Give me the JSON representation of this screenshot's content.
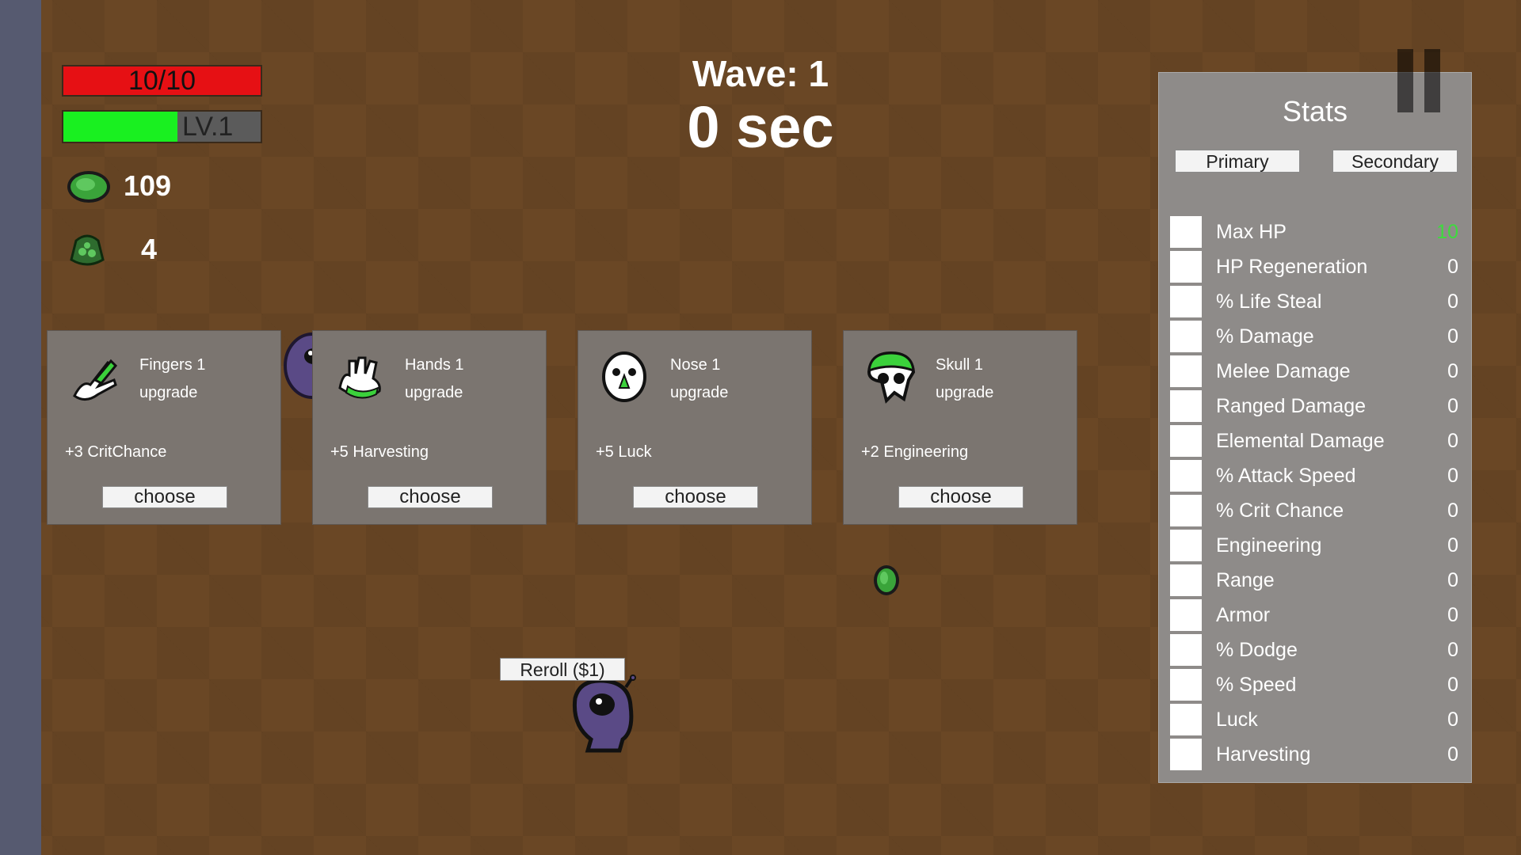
{
  "hud": {
    "hp_text": "10/10",
    "hp_fraction": 1.0,
    "level_text": "LV.1",
    "xp_fraction": 0.58,
    "materials_count": "109",
    "bag_count": "4"
  },
  "wave": {
    "title": "Wave: 1",
    "timer": "0 sec"
  },
  "cards": [
    {
      "name": "Fingers 1",
      "type": "upgrade",
      "effect": "+3 CritChance",
      "button": "choose",
      "icon": "fingers-icon"
    },
    {
      "name": "Hands 1",
      "type": "upgrade",
      "effect": "+5 Harvesting",
      "button": "choose",
      "icon": "hands-icon"
    },
    {
      "name": "Nose 1",
      "type": "upgrade",
      "effect": "+5 Luck",
      "button": "choose",
      "icon": "nose-icon"
    },
    {
      "name": "Skull 1",
      "type": "upgrade",
      "effect": "+2 Engineering",
      "button": "choose",
      "icon": "skull-icon"
    }
  ],
  "reroll_label": "Reroll ($1)",
  "stats": {
    "title": "Stats",
    "tab_primary": "Primary",
    "tab_secondary": "Secondary",
    "rows": [
      {
        "name": "Max HP",
        "value": "10"
      },
      {
        "name": "HP Regeneration",
        "value": "0"
      },
      {
        "name": "% Life Steal",
        "value": "0"
      },
      {
        "name": "% Damage",
        "value": "0"
      },
      {
        "name": "Melee Damage",
        "value": "0"
      },
      {
        "name": "Ranged Damage",
        "value": "0"
      },
      {
        "name": "Elemental Damage",
        "value": "0"
      },
      {
        "name": "% Attack Speed",
        "value": "0"
      },
      {
        "name": "% Crit Chance",
        "value": "0"
      },
      {
        "name": "Engineering",
        "value": "0"
      },
      {
        "name": "Range",
        "value": "0"
      },
      {
        "name": "Armor",
        "value": "0"
      },
      {
        "name": "% Dodge",
        "value": "0"
      },
      {
        "name": "% Speed",
        "value": "0"
      },
      {
        "name": "Luck",
        "value": "0"
      },
      {
        "name": "Harvesting",
        "value": "0"
      }
    ]
  },
  "colors": {
    "ground": "#6a4725",
    "hp": "#e61014",
    "xp": "#19f020",
    "max_hp_value": "#3ddc3d",
    "material_green": "#3aa43a"
  }
}
